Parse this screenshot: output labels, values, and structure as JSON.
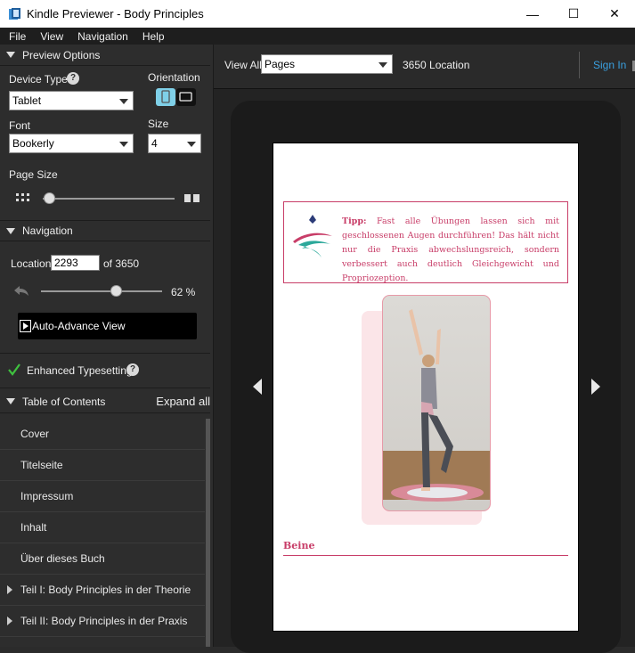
{
  "window": {
    "title": "Kindle Previewer - Body Principles",
    "minimize": "—",
    "maximize": "☐",
    "close": "✕"
  },
  "menu": [
    "File",
    "View",
    "Navigation",
    "Help"
  ],
  "preview_options": {
    "header": "Preview Options",
    "device_type_label": "Device Type",
    "device_type_value": "Tablet",
    "orientation_label": "Orientation",
    "font_label": "Font",
    "font_value": "Bookerly",
    "size_label": "Size",
    "size_value": "4",
    "page_size_label": "Page Size",
    "page_size_level": 0.05
  },
  "navigation": {
    "header": "Navigation",
    "location_label": "Location",
    "location_value": "2293",
    "of_label": "of 3650",
    "progress_percent": 62,
    "progress_text": "62 %",
    "auto_advance_label": "Auto-Advance View"
  },
  "enhanced": {
    "label": "Enhanced Typesetting"
  },
  "toc": {
    "header": "Table of Contents",
    "expand_all": "Expand all",
    "items": [
      {
        "label": "Cover",
        "expandable": false
      },
      {
        "label": "Titelseite",
        "expandable": false
      },
      {
        "label": "Impressum",
        "expandable": false
      },
      {
        "label": "Inhalt",
        "expandable": false
      },
      {
        "label": "Über dieses Buch",
        "expandable": false
      },
      {
        "label": "Teil I: Body Principles in der Theorie",
        "expandable": true
      },
      {
        "label": "Teil II: Body Principles in der Praxis",
        "expandable": true
      }
    ]
  },
  "toolbar": {
    "view_all": "View All",
    "view_mode": "Pages",
    "location_text": "3650 Location",
    "sign_in": "Sign In"
  },
  "page": {
    "tip_bold": "Tipp:",
    "tip_text": " Fast alle Übungen lassen sich mit geschlossenen Augen durchführen! Das hält nicht nur die Praxis abwechslungsreich, sondern verbessert auch deutlich Gleichgewicht und Propriozeption.",
    "heading": "Beine"
  },
  "colors": {
    "accent": "#c83d68",
    "link": "#3aa0e0",
    "panel": "#2d2d2d"
  }
}
